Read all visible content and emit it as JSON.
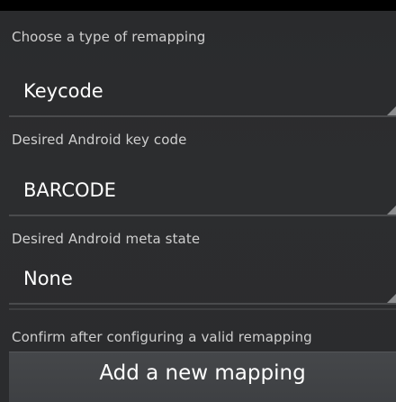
{
  "form": {
    "remapping_type": {
      "label": "Choose a type of remapping",
      "value": "Keycode"
    },
    "key_code": {
      "label": "Desired Android key code",
      "value": "BARCODE"
    },
    "meta_state": {
      "label": "Desired Android meta state",
      "value": "None"
    },
    "confirm_text": "Confirm after configuring a valid remapping",
    "add_button_label": "Add a new mapping"
  }
}
